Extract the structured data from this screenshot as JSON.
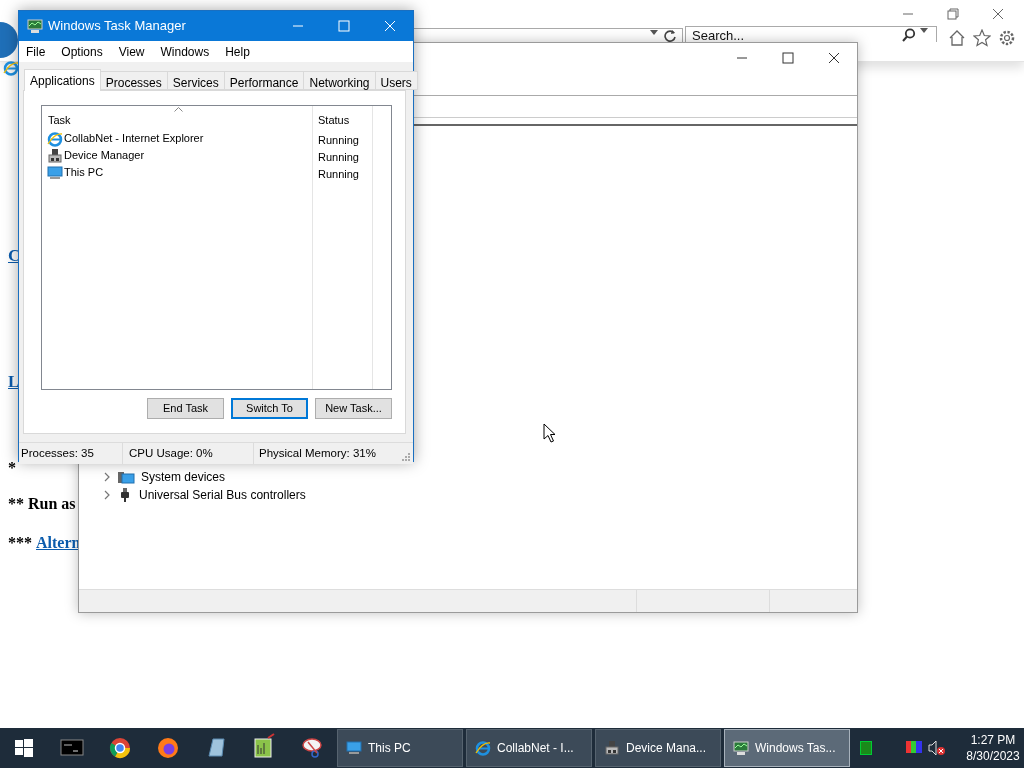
{
  "browser": {
    "search": {
      "placeholder": "Search..."
    },
    "page": [
      {
        "kind": "link",
        "text": "C"
      },
      {
        "kind": "link",
        "text": "L"
      },
      {
        "kind": "note",
        "text": "*"
      },
      {
        "kind": "note",
        "text": "** Run as"
      },
      {
        "kind": "note_link",
        "text": "*** ",
        "link": "Altern"
      }
    ]
  },
  "device_manager": {
    "tree": [
      {
        "kind": "system",
        "label": "System devices",
        "expanded": false
      },
      {
        "kind": "usb",
        "label": "Universal Serial Bus controllers",
        "expanded": false
      }
    ]
  },
  "task_manager": {
    "title": "Windows Task Manager",
    "menu": [
      "File",
      "Options",
      "View",
      "Windows",
      "Help"
    ],
    "tabs": [
      {
        "label": "Applications",
        "selected": true
      },
      {
        "label": "Processes",
        "selected": false
      },
      {
        "label": "Services",
        "selected": false
      },
      {
        "label": "Performance",
        "selected": false
      },
      {
        "label": "Networking",
        "selected": false
      },
      {
        "label": "Users",
        "selected": false
      }
    ],
    "columns": [
      "Task",
      "Status"
    ],
    "rows": [
      {
        "kind": "ie",
        "task": "CollabNet - Internet Explorer",
        "status": "Running"
      },
      {
        "kind": "devmgr",
        "task": "Device Manager",
        "status": "Running"
      },
      {
        "kind": "pc",
        "task": "This PC",
        "status": "Running"
      }
    ],
    "buttons": [
      {
        "label": "End Task",
        "default": false
      },
      {
        "label": "Switch To",
        "default": true
      },
      {
        "label": "New Task...",
        "default": false
      }
    ],
    "status_bar": [
      "Processes: 35",
      "CPU Usage: 0%",
      "Physical Memory: 31%"
    ]
  },
  "taskbar": {
    "tasks": [
      {
        "kind": "pc",
        "label": "This PC",
        "selected": false
      },
      {
        "kind": "ie",
        "label": "CollabNet - I...",
        "selected": false
      },
      {
        "kind": "devmgr",
        "label": "Device Mana...",
        "selected": false
      },
      {
        "kind": "taskmgr",
        "label": "Windows Tas...",
        "selected": true
      }
    ],
    "time": "1:27 PM",
    "date": "8/30/2023"
  }
}
